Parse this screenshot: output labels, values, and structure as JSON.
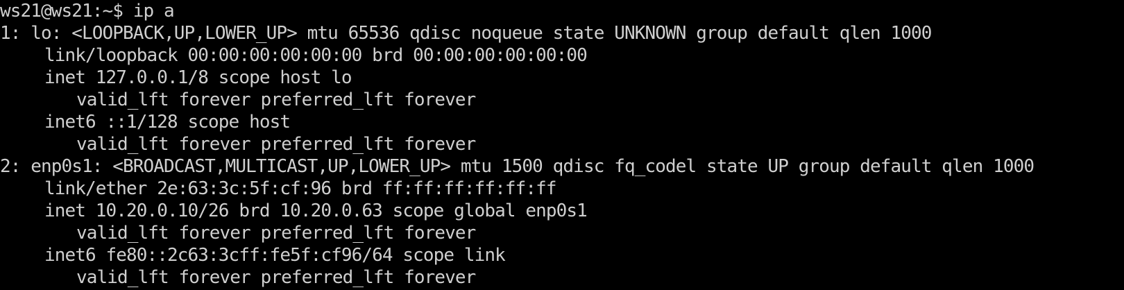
{
  "terminal": {
    "fg_color": "#cfcfcf",
    "bg_color": "#000000",
    "prompt": "ws21@ws21:~$ ip a",
    "lines": [
      "1: lo: <LOOPBACK,UP,LOWER_UP> mtu 65536 qdisc noqueue state UNKNOWN group default qlen 1000",
      "link/loopback 00:00:00:00:00:00 brd 00:00:00:00:00:00",
      "inet 127.0.0.1/8 scope host lo",
      "valid_lft forever preferred_lft forever",
      "inet6 ::1/128 scope host",
      "valid_lft forever preferred_lft forever",
      "2: enp0s1: <BROADCAST,MULTICAST,UP,LOWER_UP> mtu 1500 qdisc fq_codel state UP group default qlen 1000",
      "link/ether 2e:63:3c:5f:cf:96 brd ff:ff:ff:ff:ff:ff",
      "inet 10.20.0.10/26 brd 10.20.0.63 scope global enp0s1",
      "valid_lft forever preferred_lft forever",
      "inet6 fe80::2c63:3cff:fe5f:cf96/64 scope link",
      "valid_lft forever preferred_lft forever"
    ]
  }
}
